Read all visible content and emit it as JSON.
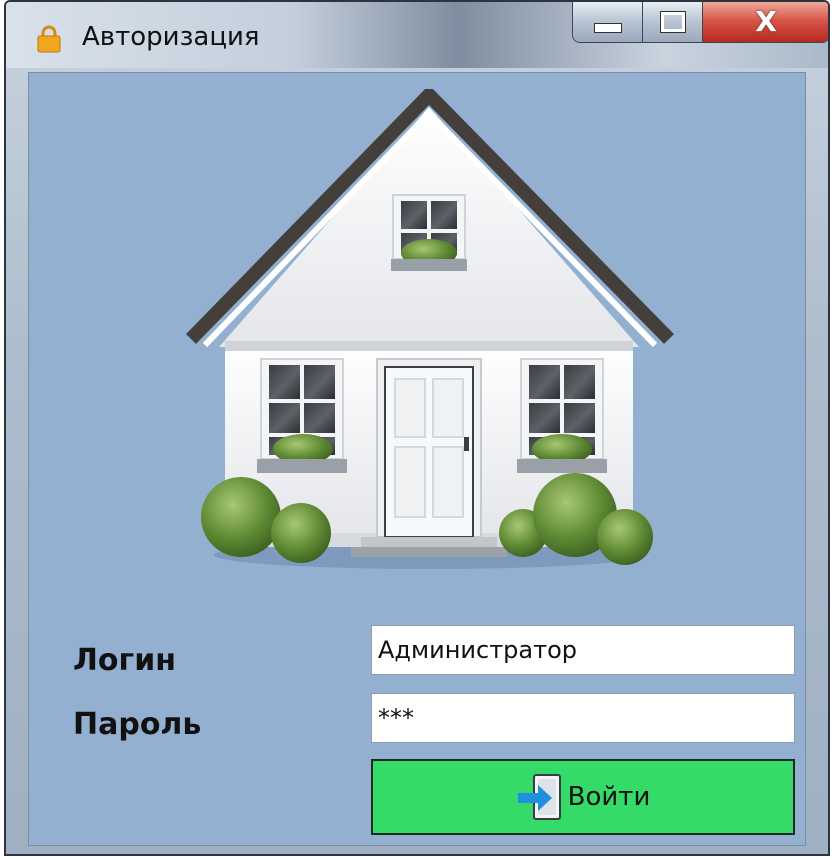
{
  "window": {
    "title": "Авторизация",
    "title_icon": "lock-icon",
    "controls": {
      "minimize_icon": "minimize-icon",
      "maximize_icon": "maximize-icon",
      "close_label": "X"
    }
  },
  "form": {
    "login_label": "Логин",
    "password_label": "Пароль",
    "login_value": "Администратор",
    "password_value": "***",
    "submit_label": "Войти",
    "submit_icon": "door-enter-icon"
  },
  "illustration": "house-icon",
  "colors": {
    "client_background": "#93b0d1",
    "submit_button": "#34db69",
    "close_button": "#c8392c"
  }
}
